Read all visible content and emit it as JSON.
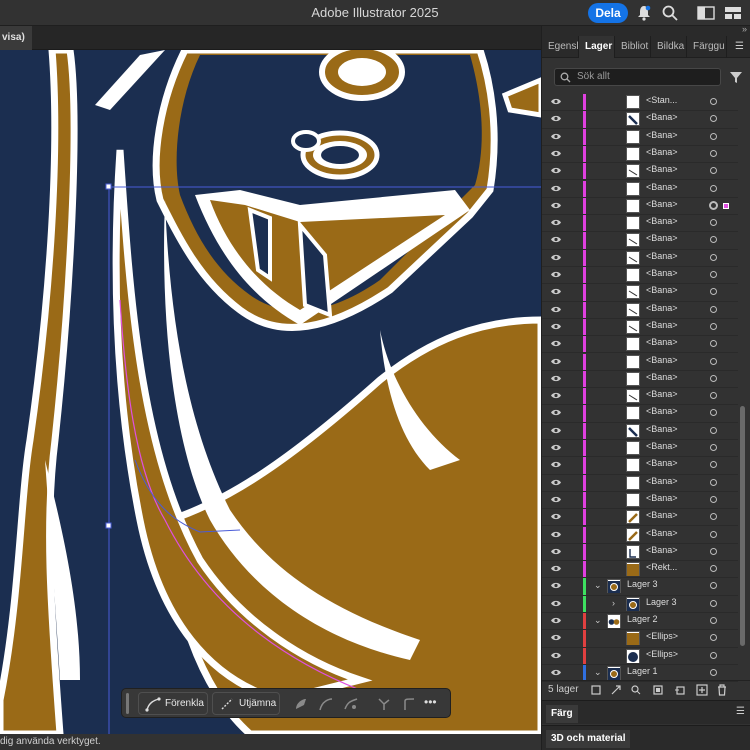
{
  "window": {
    "title": "Adobe Illustrator 2025",
    "share_label": "Dela"
  },
  "doc_tab": {
    "label": "visa)"
  },
  "status": {
    "text": "dig använda verktyget."
  },
  "context_bar": {
    "simplify_label": "Förenkla",
    "smooth_label": "Utjämna",
    "more_label": "•••"
  },
  "panel": {
    "tabs": [
      "Egensk",
      "Lager",
      "Bibliot",
      "Bildka",
      "Färggu"
    ],
    "active_tab": "Lager",
    "search_placeholder": "Sök allt",
    "footer_label": "5 lager",
    "color_panel_label": "Färg",
    "material_panel_label": "3D och material"
  },
  "layers": [
    {
      "name": "<Stan...",
      "thumb": "blank",
      "color": "#e040e0",
      "indent": 1
    },
    {
      "name": "<Bana>",
      "thumb": "stroke-navy",
      "color": "#e040e0",
      "indent": 1
    },
    {
      "name": "<Bana>",
      "thumb": "blank",
      "color": "#e040e0",
      "indent": 1
    },
    {
      "name": "<Bana>",
      "thumb": "blank",
      "color": "#e040e0",
      "indent": 1
    },
    {
      "name": "<Bana>",
      "thumb": "line",
      "color": "#e040e0",
      "indent": 1
    },
    {
      "name": "<Bana>",
      "thumb": "blank",
      "color": "#e040e0",
      "indent": 1
    },
    {
      "name": "<Bana>",
      "thumb": "blank",
      "color": "#e040e0",
      "indent": 1,
      "targeted": true
    },
    {
      "name": "<Bana>",
      "thumb": "blank",
      "color": "#e040e0",
      "indent": 1
    },
    {
      "name": "<Bana>",
      "thumb": "line",
      "color": "#e040e0",
      "indent": 1
    },
    {
      "name": "<Bana>",
      "thumb": "line",
      "color": "#e040e0",
      "indent": 1
    },
    {
      "name": "<Bana>",
      "thumb": "blank",
      "color": "#e040e0",
      "indent": 1
    },
    {
      "name": "<Bana>",
      "thumb": "line",
      "color": "#e040e0",
      "indent": 1
    },
    {
      "name": "<Bana>",
      "thumb": "line",
      "color": "#e040e0",
      "indent": 1
    },
    {
      "name": "<Bana>",
      "thumb": "line",
      "color": "#e040e0",
      "indent": 1
    },
    {
      "name": "<Bana>",
      "thumb": "blank",
      "color": "#e040e0",
      "indent": 1
    },
    {
      "name": "<Bana>",
      "thumb": "blank",
      "color": "#e040e0",
      "indent": 1
    },
    {
      "name": "<Bana>",
      "thumb": "blank",
      "color": "#e040e0",
      "indent": 1
    },
    {
      "name": "<Bana>",
      "thumb": "line",
      "color": "#e040e0",
      "indent": 1
    },
    {
      "name": "<Bana>",
      "thumb": "blank",
      "color": "#e040e0",
      "indent": 1
    },
    {
      "name": "<Bana>",
      "thumb": "stroke-navy",
      "color": "#e040e0",
      "indent": 1
    },
    {
      "name": "<Bana>",
      "thumb": "blank",
      "color": "#e040e0",
      "indent": 1
    },
    {
      "name": "<Bana>",
      "thumb": "blank",
      "color": "#e040e0",
      "indent": 1
    },
    {
      "name": "<Bana>",
      "thumb": "blank",
      "color": "#e040e0",
      "indent": 1
    },
    {
      "name": "<Bana>",
      "thumb": "blank",
      "color": "#e040e0",
      "indent": 1
    },
    {
      "name": "<Bana>",
      "thumb": "stroke-brown",
      "color": "#e040e0",
      "indent": 1
    },
    {
      "name": "<Bana>",
      "thumb": "stroke-brown",
      "color": "#e040e0",
      "indent": 1
    },
    {
      "name": "<Bana>",
      "thumb": "blank-dark",
      "color": "#e040e0",
      "indent": 1
    },
    {
      "name": "<Rekt...",
      "thumb": "fill-brown",
      "color": "#e040e0",
      "indent": 1
    },
    {
      "name": "Lager 3",
      "thumb": "art",
      "color": "#3ee060",
      "indent": 0,
      "expanded": true
    },
    {
      "name": "Lager 3",
      "thumb": "art",
      "color": "#3ee060",
      "indent": 1,
      "collapsed": true
    },
    {
      "name": "Lager 2",
      "thumb": "dots",
      "color": "#e04040",
      "indent": 0,
      "expanded": true
    },
    {
      "name": "<Ellips>",
      "thumb": "fill-brown",
      "color": "#e04040",
      "indent": 1
    },
    {
      "name": "<Ellips>",
      "thumb": "fill-navy",
      "color": "#e04040",
      "indent": 1
    },
    {
      "name": "Lager 1",
      "thumb": "art",
      "color": "#3070e0",
      "indent": 0,
      "expanded": true
    }
  ],
  "colors": {
    "canvas_navy": "#1b2e50",
    "art_brown": "#9a6a17",
    "accent_blue": "#1473e6",
    "selection_blue": "#4a5cd8",
    "path_magenta": "#e050e0"
  }
}
